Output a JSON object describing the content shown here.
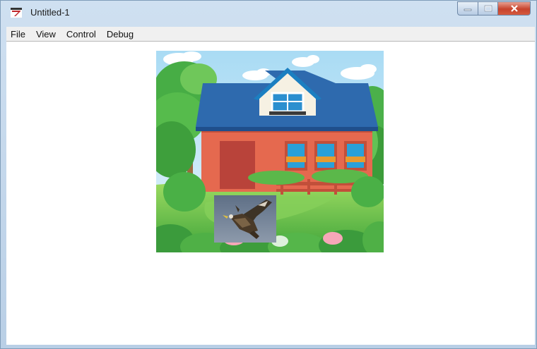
{
  "window": {
    "title": "Untitled-1",
    "app_icon": "flash-player-icon",
    "controls": [
      "minimize-icon",
      "maximize-icon",
      "close-icon"
    ]
  },
  "menu": {
    "items": [
      {
        "label": "File"
      },
      {
        "label": "View"
      },
      {
        "label": "Control"
      },
      {
        "label": "Debug"
      }
    ]
  },
  "stage": {
    "background_image": "house-scene",
    "sprite_image": "eagle-sprite"
  },
  "colors": {
    "roof": "#2e6aae",
    "walls": "#e5694f",
    "grass": "#5fbf3f",
    "sky": "#bfe3f6",
    "close_button": "#c7432c"
  }
}
